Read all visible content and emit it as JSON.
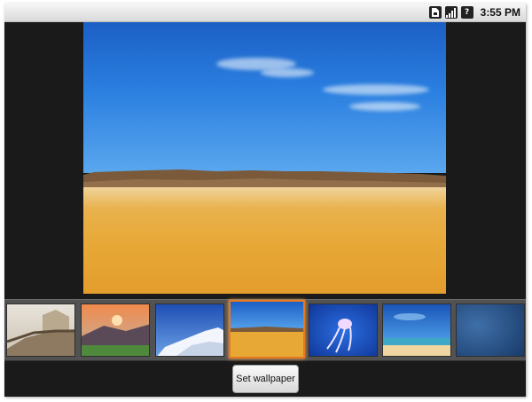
{
  "status_bar": {
    "time": "3:55 PM",
    "icons": [
      "sim-card-icon",
      "signal-icon",
      "help-icon"
    ],
    "help_glyph": "?"
  },
  "preview": {
    "description_icon": "wallpaper-preview",
    "colors": {
      "sky_top": "#1c5fc5",
      "sand": "#e7a836"
    }
  },
  "thumbnails": {
    "selected_index": 3,
    "items": [
      {
        "name": "thumbnail-great-wall"
      },
      {
        "name": "thumbnail-sunset-mountains"
      },
      {
        "name": "thumbnail-snowy-peaks"
      },
      {
        "name": "thumbnail-desert"
      },
      {
        "name": "thumbnail-jellyfish"
      },
      {
        "name": "thumbnail-beach-sky"
      },
      {
        "name": "thumbnail-blue-gradient"
      }
    ]
  },
  "actions": {
    "set_wallpaper_label": "Set wallpaper"
  },
  "accent_color": "#e8791f"
}
